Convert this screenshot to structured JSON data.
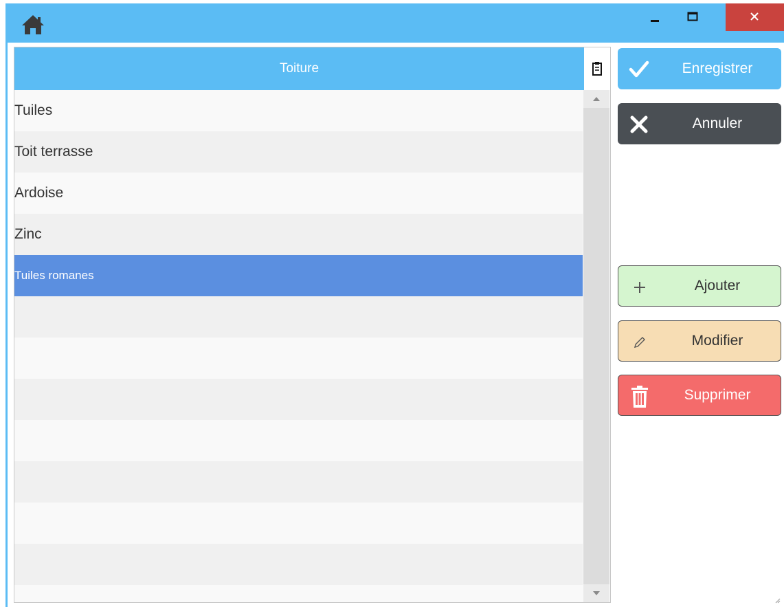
{
  "window": {
    "accent_color": "#5bbcf4",
    "controls": [
      "minimize-icon",
      "maximize-icon",
      "close-icon"
    ]
  },
  "table": {
    "column_header": "Toiture",
    "rows": [
      "Tuiles",
      "Toit terrasse",
      "Ardoise",
      "Zinc",
      "Tuiles romanes",
      "",
      "",
      "",
      "",
      "",
      "",
      "",
      ""
    ],
    "selected_row": "Tuiles romanes"
  },
  "actions": {
    "save_label": "Enregistrer",
    "cancel_label": "Annuler",
    "add_label": "Ajouter",
    "edit_label": "Modifier",
    "delete_label": "Supprimer"
  },
  "colors": {
    "save": "#5bbcf4",
    "cancel": "#4a4f54",
    "add": "#d5f5cf",
    "edit": "#f7ddb4",
    "delete": "#f46b6b",
    "selection": "#5b8fe0"
  }
}
